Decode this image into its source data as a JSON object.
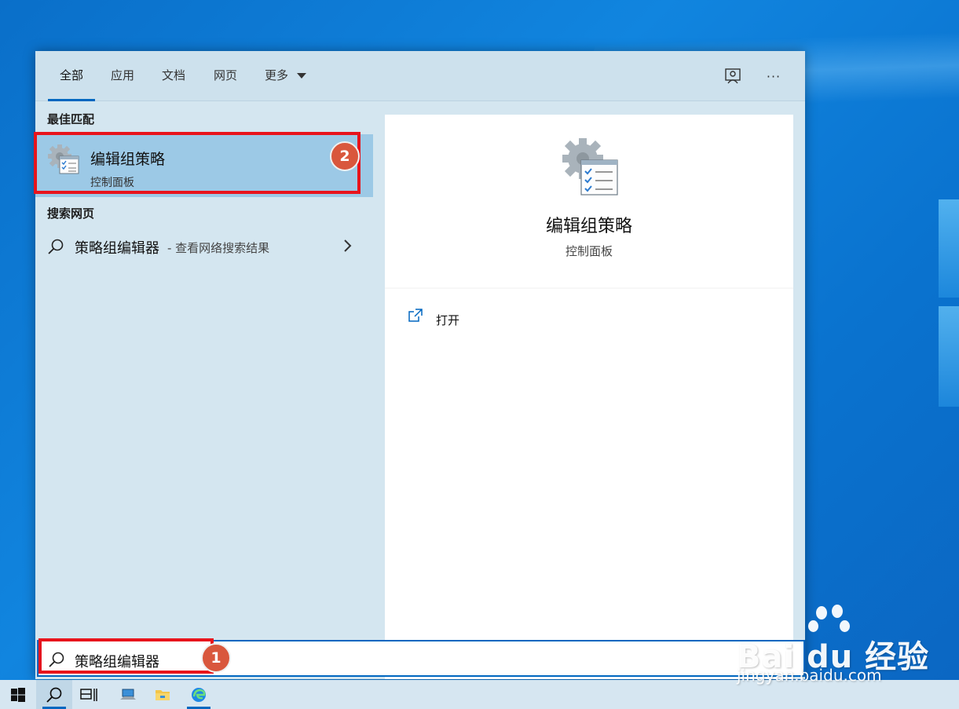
{
  "tabs": [
    {
      "label": "全部",
      "active": true
    },
    {
      "label": "应用",
      "active": false
    },
    {
      "label": "文档",
      "active": false
    },
    {
      "label": "网页",
      "active": false
    },
    {
      "label": "更多",
      "active": false
    }
  ],
  "top_icons": [
    "feedback-icon",
    "more-options-icon"
  ],
  "more_label": "···",
  "best_match": {
    "heading": "最佳匹配",
    "title": "编辑组策略",
    "subtitle": "控制面板",
    "badge": "2"
  },
  "web_search": {
    "heading": "搜索网页",
    "query": "策略组编辑器",
    "suffix": "- 查看网络搜索结果"
  },
  "preview": {
    "title": "编辑组策略",
    "subtitle": "控制面板",
    "open_label": "打开"
  },
  "search": {
    "value": "策略组编辑器",
    "badge": "1"
  },
  "taskbar": {
    "items": [
      "windows-start-icon",
      "search-icon",
      "task-view-icon",
      "network-app-icon",
      "file-explorer-icon",
      "edge-icon"
    ]
  },
  "watermark": {
    "brand": "Bai du 经验",
    "url": "jingyan.baidu.com"
  },
  "colors": {
    "accent": "#0067c0",
    "highlight": "#9cc9e6",
    "annotation_red": "#e8141c",
    "badge": "#d9573d"
  }
}
